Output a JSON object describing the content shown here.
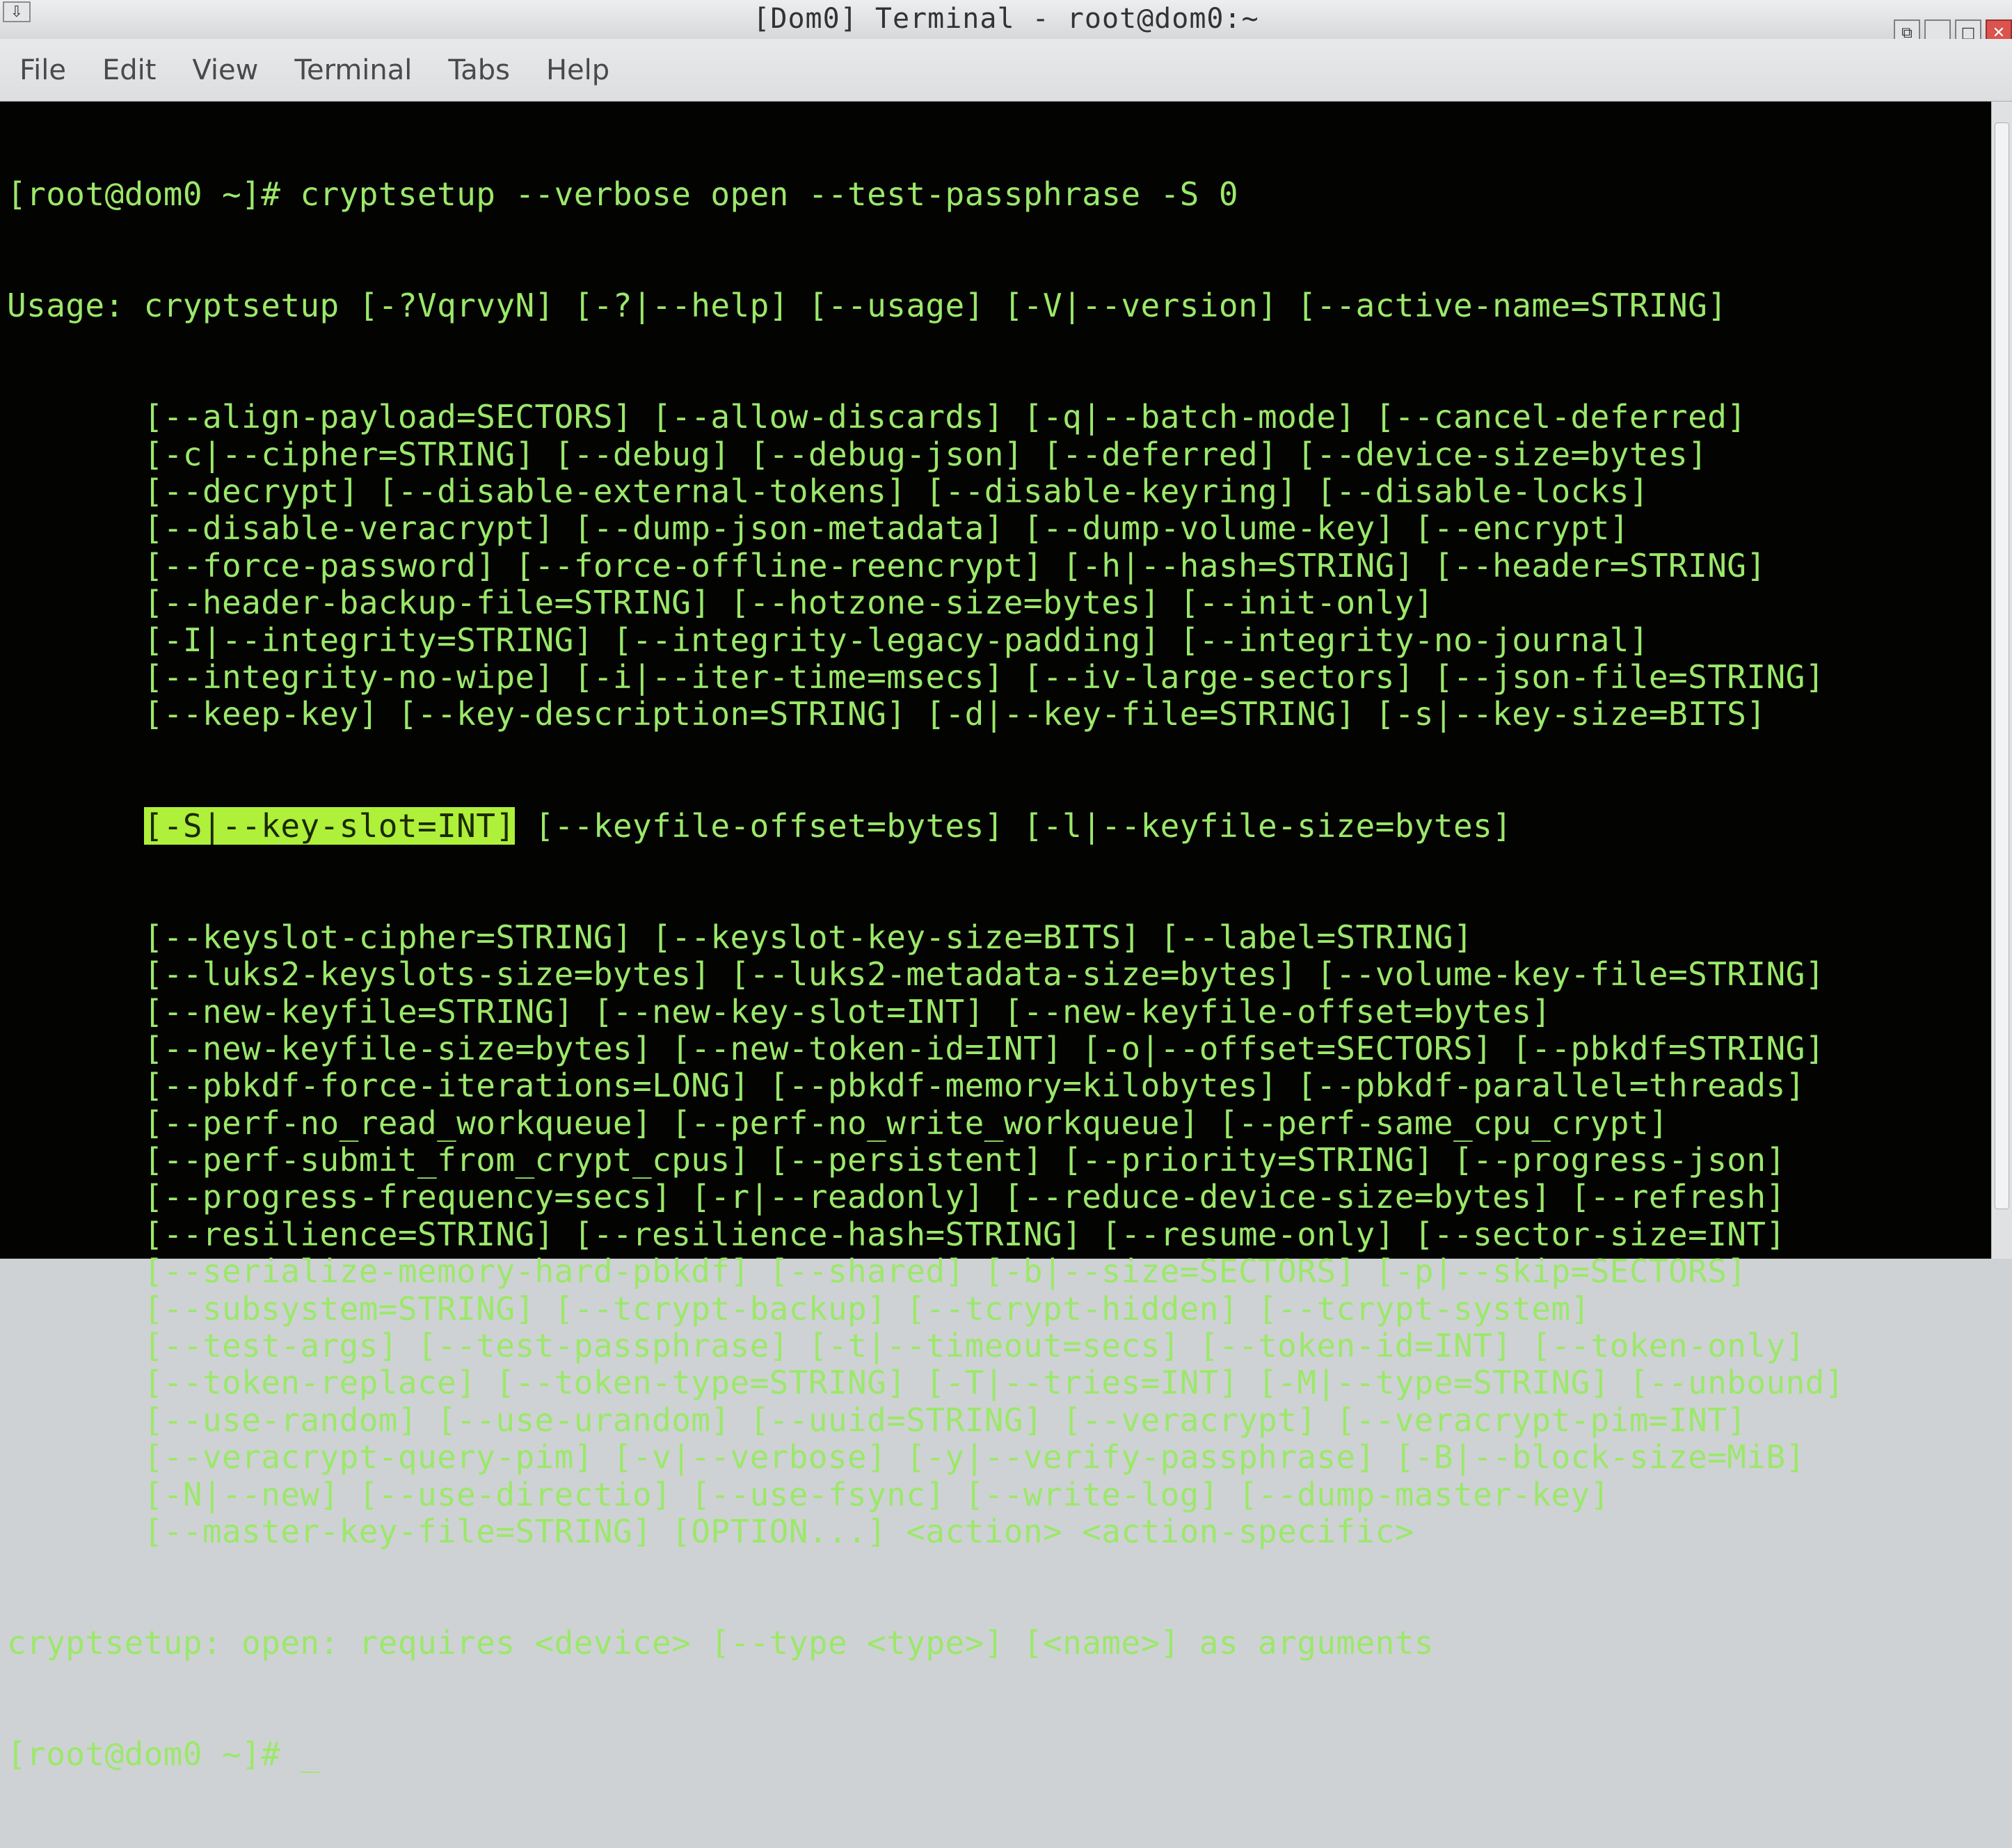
{
  "window": {
    "title": "[Dom0] Terminal - root@dom0:~",
    "menu_icon": "window-menu-icon",
    "controls": [
      "restore-icon",
      "minimize-icon",
      "maximize-icon",
      "close-icon"
    ]
  },
  "menubar": {
    "items": [
      "File",
      "Edit",
      "View",
      "Terminal",
      "Tabs",
      "Help"
    ]
  },
  "terminal": {
    "colors": {
      "background": "#030302",
      "text": "#9be86a",
      "highlight": "#aef03a"
    },
    "command_line": "[root@dom0 ~]# cryptsetup --verbose open --test-passphrase -S 0",
    "usage_first": "Usage: cryptsetup [-?VqrvyN] [-?|--help] [--usage] [-V|--version] [--active-name=STRING]",
    "usage_lines": [
      "[--align-payload=SECTORS] [--allow-discards] [-q|--batch-mode] [--cancel-deferred]",
      "[-c|--cipher=STRING] [--debug] [--debug-json] [--deferred] [--device-size=bytes]",
      "[--decrypt] [--disable-external-tokens] [--disable-keyring] [--disable-locks]",
      "[--disable-veracrypt] [--dump-json-metadata] [--dump-volume-key] [--encrypt]",
      "[--force-password] [--force-offline-reencrypt] [-h|--hash=STRING] [--header=STRING]",
      "[--header-backup-file=STRING] [--hotzone-size=bytes] [--init-only]",
      "[-I|--integrity=STRING] [--integrity-legacy-padding] [--integrity-no-journal]",
      "[--integrity-no-wipe] [-i|--iter-time=msecs] [--iv-large-sectors] [--json-file=STRING]",
      "[--keep-key] [--key-description=STRING] [-d|--key-file=STRING] [-s|--key-size=BITS]"
    ],
    "highlighted": "[-S|--key-slot=INT]",
    "highlighted_rest": " [--keyfile-offset=bytes] [-l|--keyfile-size=bytes]",
    "usage_lines_2": [
      "[--keyslot-cipher=STRING] [--keyslot-key-size=BITS] [--label=STRING]",
      "[--luks2-keyslots-size=bytes] [--luks2-metadata-size=bytes] [--volume-key-file=STRING]",
      "[--new-keyfile=STRING] [--new-key-slot=INT] [--new-keyfile-offset=bytes]",
      "[--new-keyfile-size=bytes] [--new-token-id=INT] [-o|--offset=SECTORS] [--pbkdf=STRING]",
      "[--pbkdf-force-iterations=LONG] [--pbkdf-memory=kilobytes] [--pbkdf-parallel=threads]",
      "[--perf-no_read_workqueue] [--perf-no_write_workqueue] [--perf-same_cpu_crypt]",
      "[--perf-submit_from_crypt_cpus] [--persistent] [--priority=STRING] [--progress-json]",
      "[--progress-frequency=secs] [-r|--readonly] [--reduce-device-size=bytes] [--refresh]",
      "[--resilience=STRING] [--resilience-hash=STRING] [--resume-only] [--sector-size=INT]",
      "[--serialize-memory-hard-pbkdf] [--shared] [-b|--size=SECTORS] [-p|--skip=SECTORS]",
      "[--subsystem=STRING] [--tcrypt-backup] [--tcrypt-hidden] [--tcrypt-system]",
      "[--test-args] [--test-passphrase] [-t|--timeout=secs] [--token-id=INT] [--token-only]",
      "[--token-replace] [--token-type=STRING] [-T|--tries=INT] [-M|--type=STRING] [--unbound]",
      "[--use-random] [--use-urandom] [--uuid=STRING] [--veracrypt] [--veracrypt-pim=INT]",
      "[--veracrypt-query-pim] [-v|--verbose] [-y|--verify-passphrase] [-B|--block-size=MiB]",
      "[-N|--new] [--use-directio] [--use-fsync] [--write-log] [--dump-master-key]",
      "[--master-key-file=STRING] [OPTION...] <action> <action-specific>"
    ],
    "error_line": "cryptsetup: open: requires <device> [--type <type>] [<name>] as arguments",
    "prompt": "[root@dom0 ~]# ",
    "cursor": "_"
  }
}
